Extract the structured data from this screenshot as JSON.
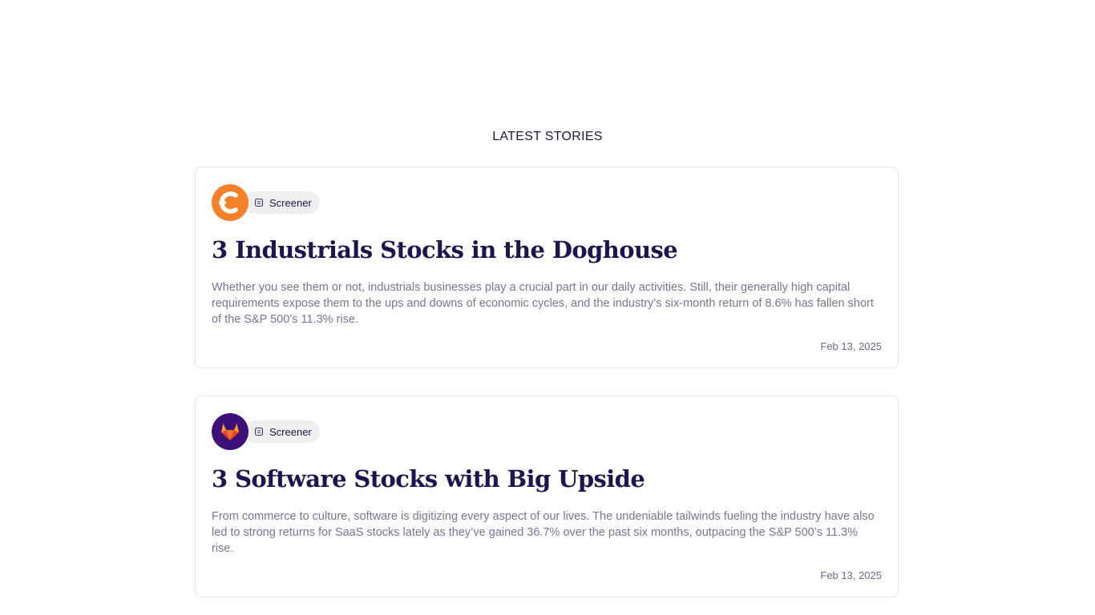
{
  "section": {
    "title": "LATEST STORIES"
  },
  "stories": [
    {
      "avatar_icon": "orange-c-logo-icon",
      "tag_icon": "document-icon",
      "tag": "Screener",
      "title": "3 Industrials Stocks in the Doghouse",
      "excerpt": "Whether you see them or not, industrials businesses play a crucial part in our daily activities. Still, their generally high capital requirements expose them to the ups and downs of economic cycles, and the industry’s six-month return of 8.6% has fallen short of the S&P 500’s 11.3% rise.",
      "date": "Feb 13, 2025",
      "avatar_color": "#f7812a"
    },
    {
      "avatar_icon": "gitlab-fox-logo-icon",
      "tag_icon": "document-icon",
      "tag": "Screener",
      "title": "3 Software Stocks with Big Upside",
      "excerpt": "From commerce to culture, software is digitizing every aspect of our lives. The undeniable tailwinds fueling the industry have also led to strong returns for SaaS stocks lately as they’ve gained 36.7% over the past six months, outpacing the S&P 500’s 11.3% rise.",
      "date": "Feb 13, 2025",
      "avatar_color": "#3b1078"
    }
  ]
}
